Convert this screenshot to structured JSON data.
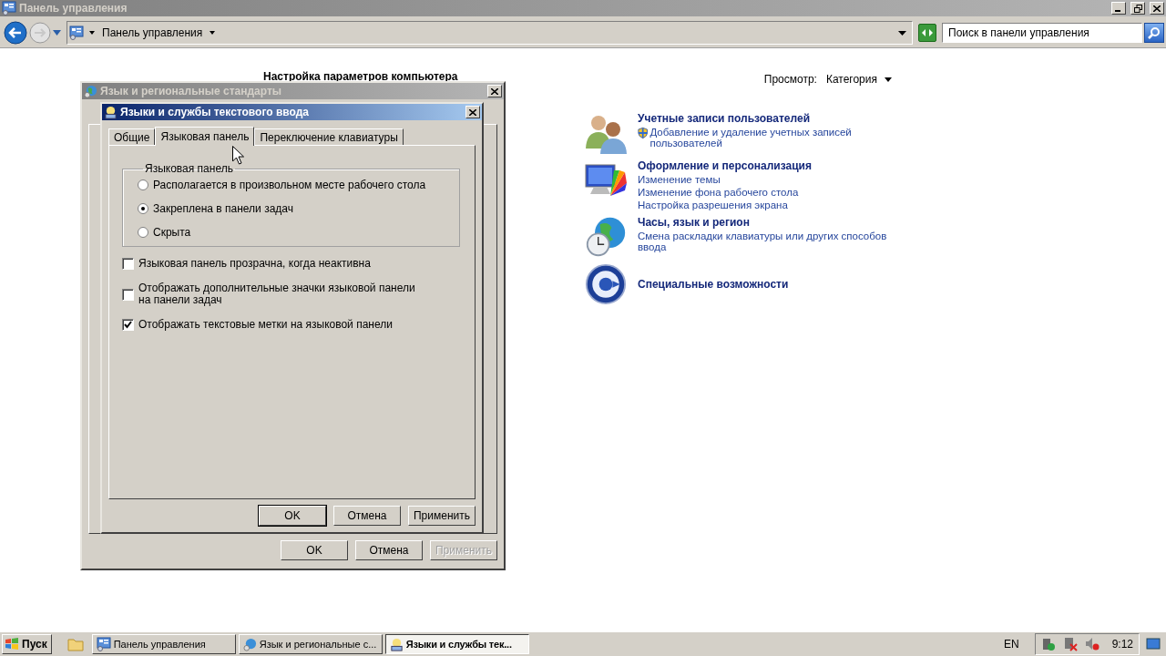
{
  "window": {
    "title": "Панель управления",
    "active": false
  },
  "address_bar": {
    "path": "Панель управления"
  },
  "search": {
    "placeholder": "Поиск в панели управления"
  },
  "content": {
    "heading": "Настройка параметров компьютера",
    "view_label": "Просмотр:",
    "view_value": "Категория"
  },
  "categories": [
    {
      "kind": "users",
      "title": "Учетные записи пользователей",
      "links": [
        {
          "text": "Добавление и удаление учетных записей пользователей",
          "shield": true
        }
      ]
    },
    {
      "kind": "appearance",
      "title": "Оформление и персонализация",
      "links": [
        {
          "text": "Изменение темы",
          "shield": false
        },
        {
          "text": "Изменение фона рабочего стола",
          "shield": false
        },
        {
          "text": "Настройка разрешения экрана",
          "shield": false
        }
      ]
    },
    {
      "kind": "clock",
      "title": "Часы, язык и регион",
      "links": [
        {
          "text": "Смена раскладки клавиатуры или других способов ввода",
          "shield": false
        }
      ]
    },
    {
      "kind": "access",
      "title": "Специальные возможности"
    }
  ],
  "dialogs": [
    {
      "title": "Язык и региональные стандарты",
      "active": false,
      "buttons": [
        {
          "label": "OK",
          "default": false,
          "disabled": false
        },
        {
          "label": "Отмена",
          "default": false,
          "disabled": false
        },
        {
          "label": "Применить",
          "default": false,
          "disabled": true
        }
      ]
    },
    {
      "title": "Языки и службы текстового ввода",
      "active": true,
      "tabs": [
        {
          "label": "Общие",
          "selected": false
        },
        {
          "label": "Языковая панель",
          "selected": true
        },
        {
          "label": "Переключение клавиатуры",
          "selected": false
        }
      ],
      "group": {
        "legend": "Языковая панель",
        "options": [
          {
            "label": "Располагается в произвольном месте рабочего стола",
            "selected": false
          },
          {
            "label": "Закреплена в панели задач",
            "selected": true
          },
          {
            "label": "Скрыта",
            "selected": false
          }
        ]
      },
      "checkboxes": [
        {
          "label": "Языковая панель прозрачна, когда неактивна",
          "checked": false
        },
        {
          "label": "Отображать дополнительные значки языковой панели на панели задач",
          "checked": false
        },
        {
          "label": "Отображать текстовые метки на языковой панели",
          "checked": true
        }
      ],
      "buttons": [
        {
          "label": "OK",
          "default": true,
          "disabled": false
        },
        {
          "label": "Отмена",
          "default": false,
          "disabled": false
        },
        {
          "label": "Применить",
          "default": false,
          "disabled": false
        }
      ]
    }
  ],
  "taskbar": {
    "start": "Пуск",
    "tasks": [
      {
        "label": "Панель управления",
        "selected": false
      },
      {
        "label": "Язык и региональные с...",
        "selected": false
      },
      {
        "label": "Языки и службы тек...",
        "selected": true
      }
    ],
    "language": "EN",
    "time": "9:12"
  }
}
